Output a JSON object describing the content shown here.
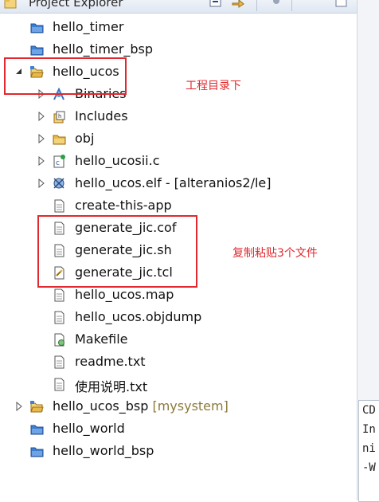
{
  "view": {
    "title": "Project Explorer"
  },
  "tree": [
    {
      "label": "hello_timer",
      "icon": "folder-blue-icon"
    },
    {
      "label": "hello_timer_bsp",
      "icon": "folder-blue-icon"
    },
    {
      "label": "hello_ucos",
      "icon": "project-open-folder-icon",
      "expanded": true
    },
    {
      "label": "Binaries",
      "icon": "binaries-icon"
    },
    {
      "label": "Includes",
      "icon": "includes-icon"
    },
    {
      "label": "obj",
      "icon": "folder-yellow-icon"
    },
    {
      "label": "hello_ucosii.c",
      "icon": "c-source-file-icon"
    },
    {
      "label": "hello_ucos.elf - [alteranios2/le]",
      "icon": "elf-binary-icon"
    },
    {
      "label": "create-this-app",
      "icon": "text-file-icon"
    },
    {
      "label": "generate_jic.cof",
      "icon": "text-file-icon"
    },
    {
      "label": "generate_jic.sh",
      "icon": "text-file-icon"
    },
    {
      "label": "generate_jic.tcl",
      "icon": "tcl-file-icon"
    },
    {
      "label": "hello_ucos.map",
      "icon": "text-file-icon"
    },
    {
      "label": "hello_ucos.objdump",
      "icon": "text-file-icon"
    },
    {
      "label": "Makefile",
      "icon": "makefile-icon"
    },
    {
      "label": "readme.txt",
      "icon": "text-file-icon"
    },
    {
      "label": "使用说明.txt",
      "icon": "text-file-icon"
    },
    {
      "label": "hello_ucos_bsp",
      "decoration": "[mysystem]",
      "icon": "project-folder-icon"
    },
    {
      "label": "hello_world",
      "icon": "folder-blue-icon"
    },
    {
      "label": "hello_world_bsp",
      "icon": "folder-blue-icon"
    }
  ],
  "annotations": {
    "project_dir": "工程目录下",
    "copy_files": "复制粘贴3个文件"
  },
  "side_panel": {
    "lines": [
      "CD",
      "In",
      "ni",
      "-W"
    ]
  },
  "colors": {
    "annotation_red": "#e0282e",
    "folder_blue": "#3d7fd1",
    "folder_yellow": "#e8b84a"
  }
}
